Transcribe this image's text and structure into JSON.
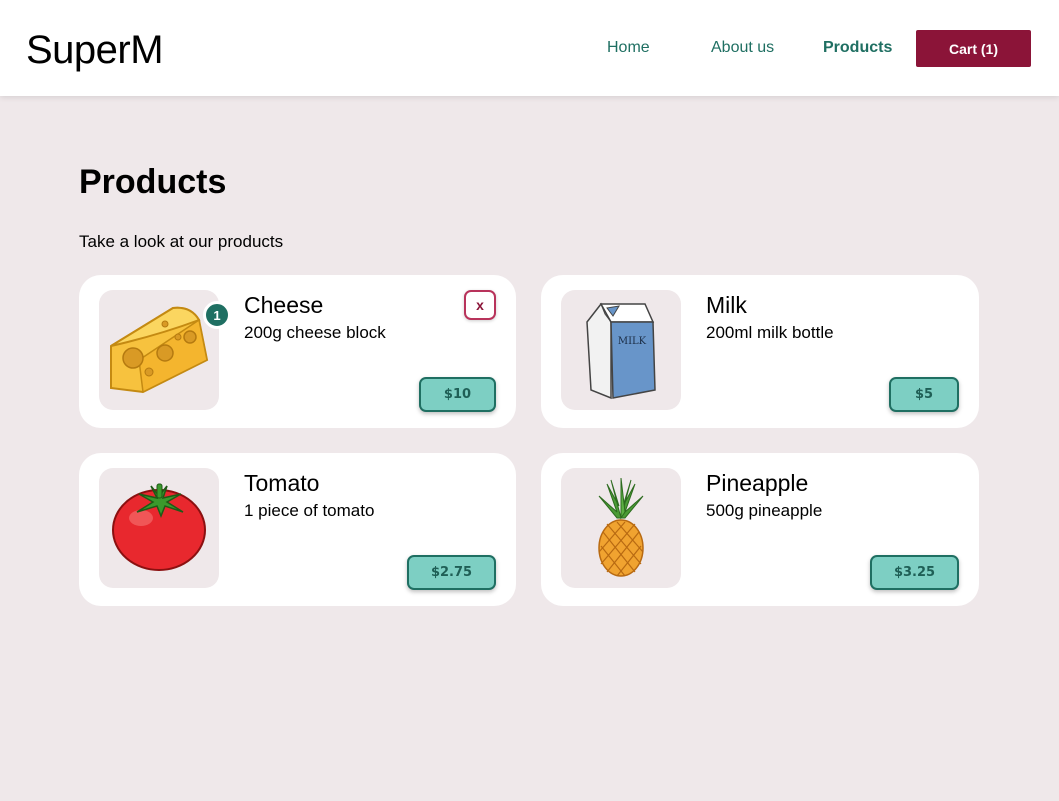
{
  "navbar": {
    "brand": "SuperM",
    "links": [
      "Home",
      "About us",
      "Products"
    ],
    "active": "Products",
    "cart_label": "Cart (1)"
  },
  "page": {
    "title": "Products",
    "subtitle": "Take a look at our products"
  },
  "colors": {
    "accent": "#1f6f62",
    "cart": "#8b1438",
    "price_bg": "#7dcfc3",
    "page_bg": "#efe8ea"
  },
  "products": [
    {
      "name": "Cheese",
      "description": "200g cheese block",
      "price": "$10",
      "quantity": "1",
      "remove_label": "x",
      "icon": "cheese-icon"
    },
    {
      "name": "Milk",
      "description": "200ml milk bottle",
      "price": "$5",
      "icon": "milk-icon",
      "carton_text": "MILK"
    },
    {
      "name": "Tomato",
      "description": "1 piece of tomato",
      "price": "$2.75",
      "icon": "tomato-icon"
    },
    {
      "name": "Pineapple",
      "description": "500g pineapple",
      "price": "$3.25",
      "icon": "pineapple-icon"
    }
  ]
}
